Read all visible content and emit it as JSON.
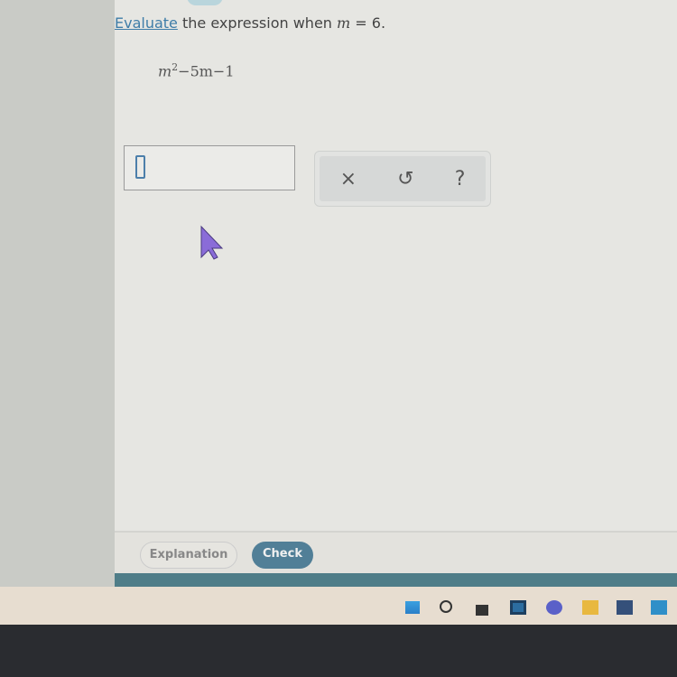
{
  "question": {
    "link_word": "Evaluate",
    "prompt_rest": " the expression when ",
    "variable": "m",
    "equals": " = 6."
  },
  "expression": {
    "base": "m",
    "exponent": "2",
    "rest": "−5m−1"
  },
  "answer": {
    "value": ""
  },
  "tools": {
    "clear": "×",
    "undo": "↺",
    "help": "?"
  },
  "footer": {
    "explanation": "Explanation",
    "check": "Check"
  },
  "colors": {
    "accent": "#517f97",
    "link": "#3f7da8"
  },
  "taskbar": {
    "icons": [
      "windows-start-icon",
      "search-icon",
      "widgets-icon",
      "task-view-icon",
      "teams-chat-icon",
      "file-explorer-icon",
      "store-icon",
      "mail-icon"
    ]
  }
}
